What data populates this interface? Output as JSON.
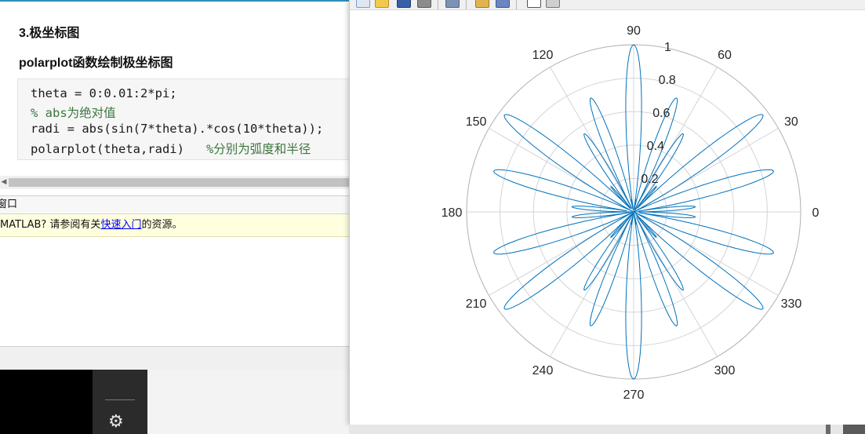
{
  "editor": {
    "section_title": "3.极坐标图",
    "sub_title": "polarplot函数绘制极坐标图",
    "code": {
      "line1": "theta = 0:0.01:2*pi;",
      "line2": "% abs为绝对值",
      "line3": "radi = abs(sin(7*theta).*cos(10*theta));",
      "line4_code": "polarplot(theta,radi)   ",
      "line4_comment": "%分别为弧度和半径"
    }
  },
  "command_window": {
    "title": "窗口",
    "notice_prefix": "MATLAB? 请参阅有关",
    "notice_link": "快速入门",
    "notice_suffix": "的资源。"
  },
  "icons": {
    "gear": "⚙",
    "scroll_left": "◀"
  },
  "colors": {
    "plot_line": "#0072bd",
    "grid": "#d4d4d4",
    "accent": "#2d8fb8"
  },
  "chart_data": {
    "type": "line",
    "coordinate_system": "polar",
    "function": "r = abs(sin(7*theta).*cos(10*theta))",
    "theta_range": [
      0,
      6.283
    ],
    "theta_step": 0.01,
    "rlim": [
      0,
      1
    ],
    "r_ticks": [
      "0.2",
      "0.4",
      "0.6",
      "0.8",
      "1"
    ],
    "theta_ticks": [
      "0",
      "30",
      "60",
      "90",
      "120",
      "150",
      "180",
      "210",
      "240",
      "270",
      "300",
      "330"
    ],
    "grid": true
  }
}
